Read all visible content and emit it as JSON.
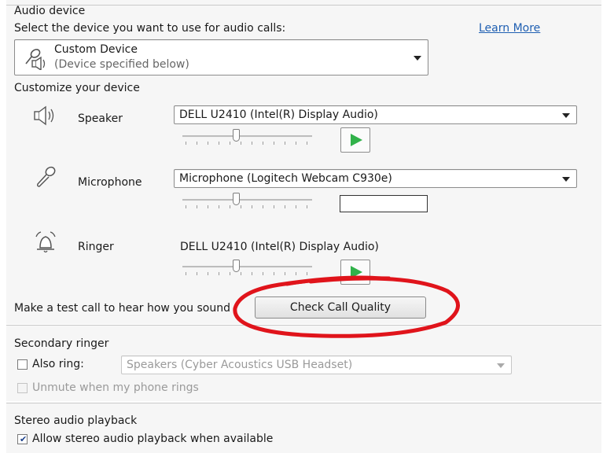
{
  "audio_device": {
    "heading": "Audio device",
    "prompt": "Select the device you want to use for audio calls:",
    "learn_more": "Learn More",
    "device": {
      "name": "Custom Device",
      "sub": "(Device specified below)"
    }
  },
  "customize": {
    "heading": "Customize your device",
    "speaker": {
      "label": "Speaker",
      "value": "DELL U2410 (Intel(R) Display Audio)",
      "volume": 0.4
    },
    "microphone": {
      "label": "Microphone",
      "value": "Microphone (Logitech Webcam C930e)",
      "volume": 0.4
    },
    "ringer": {
      "label": "Ringer",
      "value": "DELL U2410 (Intel(R) Display Audio)",
      "volume": 0.4
    }
  },
  "test_call": {
    "text": "Make a test call to hear how you sound",
    "button": "Check Call Quality"
  },
  "secondary_ringer": {
    "heading": "Secondary ringer",
    "also_ring_label": "Also ring:",
    "also_ring_checked": false,
    "also_ring_value": "Speakers (Cyber Acoustics USB Headset)",
    "unmute_label": "Unmute when my phone rings",
    "unmute_checked": false
  },
  "stereo": {
    "heading": "Stereo audio playback",
    "allow_label": "Allow stereo audio playback when available",
    "allow_checked": true
  },
  "colors": {
    "play_green": "#31b24a",
    "highlight_red": "#e0141b",
    "link_blue": "#1f5fb2"
  }
}
